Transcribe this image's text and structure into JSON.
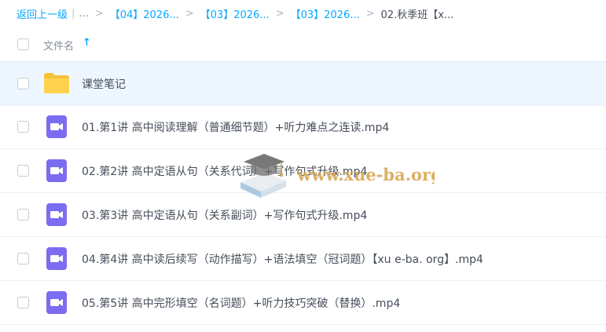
{
  "breadcrumb": {
    "back_label": "返回上一级",
    "separator": "|",
    "ellipsis": "...",
    "arrow": ">",
    "items": [
      "【04】2026...",
      "【03】2026...",
      "【03】2026..."
    ],
    "current": "02.秋季班【x..."
  },
  "list_header": {
    "column_label": "文件名",
    "sort_arrow": "↑"
  },
  "files": [
    {
      "name": "课堂笔记",
      "icon": "folder-icon"
    },
    {
      "name": "01.第1讲 高中阅读理解（普通细节题）+听力难点之连读.mp4",
      "icon": "video-icon"
    },
    {
      "name": "02.第2讲 高中定语从句（关系代词）+写作句式升级.mp4",
      "icon": "video-icon"
    },
    {
      "name": "03.第3讲 高中定语从句（关系副词）+写作句式升级.mp4",
      "icon": "video-icon"
    },
    {
      "name": "04.第4讲 高中读后续写（动作描写）+语法填空（冠词题）【xu e-ba. org】.mp4",
      "icon": "video-icon"
    },
    {
      "name": "05.第5讲 高中完形填空（名词题）+听力技巧突破（替换）.mp4",
      "icon": "video-icon"
    }
  ],
  "watermark": {
    "text": "www.xue-ba.org",
    "color": "#d6a24a"
  },
  "colors": {
    "accent": "#06a7ff",
    "folder": "#ffd34f",
    "video": "#7b6cf2",
    "selected_row": "#eef7ff"
  }
}
